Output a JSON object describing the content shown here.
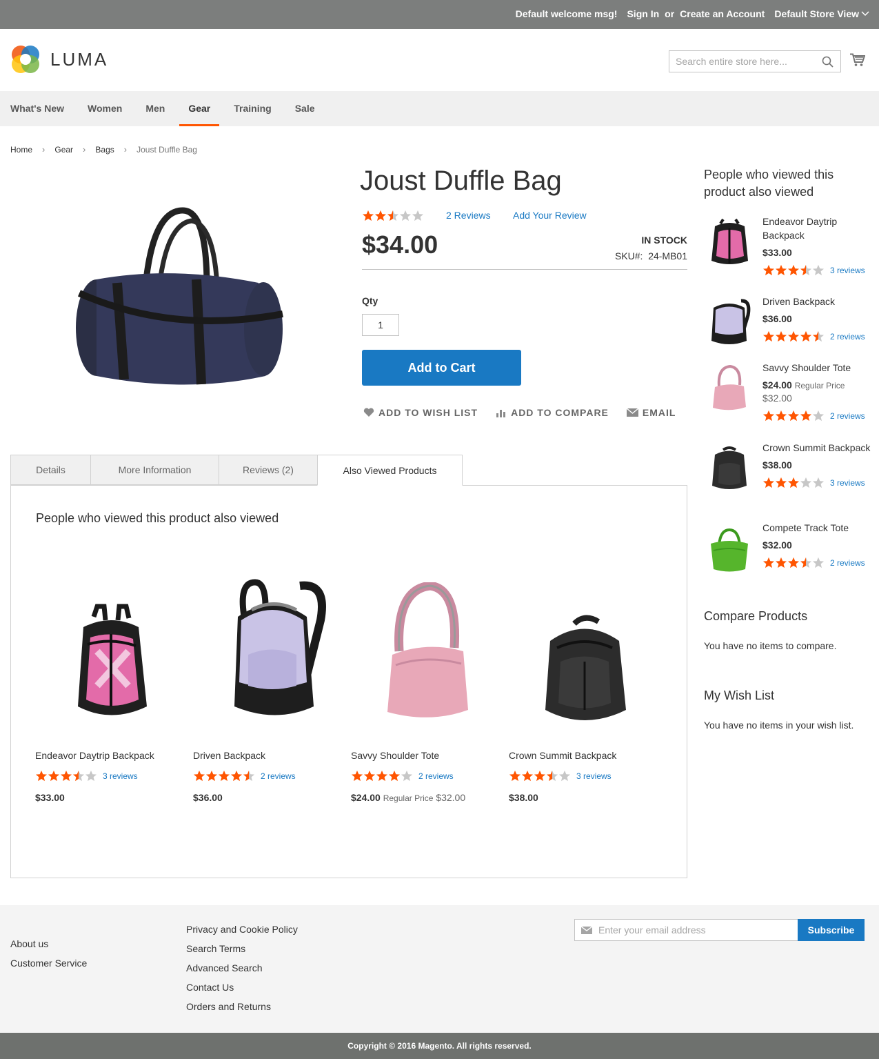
{
  "header": {
    "welcome": "Default welcome msg!",
    "sign_in": "Sign In",
    "or": "or",
    "create_account": "Create an Account",
    "store_view": "Default Store View",
    "logo_text": "LUMA",
    "search_placeholder": "Search entire store here..."
  },
  "nav": {
    "items": [
      "What's New",
      "Women",
      "Men",
      "Gear",
      "Training",
      "Sale"
    ],
    "active": "Gear"
  },
  "breadcrumb": [
    "Home",
    "Gear",
    "Bags",
    "Joust Duffle Bag"
  ],
  "product": {
    "title": "Joust Duffle Bag",
    "rating": 2.5,
    "reviews_link": "2 Reviews",
    "add_review": "Add Your Review",
    "price": "$34.00",
    "stock": "IN STOCK",
    "sku_label": "SKU#:",
    "sku": "24-MB01",
    "qty_label": "Qty",
    "qty": "1",
    "add_to_cart": "Add to Cart",
    "wish_list": "ADD TO WISH LIST",
    "compare": "ADD TO COMPARE",
    "email": "EMAIL"
  },
  "tabs": [
    "Details",
    "More Information",
    "Reviews (2)",
    "Also Viewed Products"
  ],
  "active_tab": "Also Viewed Products",
  "also_viewed": {
    "title": "People who viewed this product also viewed",
    "items": [
      {
        "name": "Endeavor Daytrip Backpack",
        "rating": 3.5,
        "reviews": "3 reviews",
        "price": "$33.00",
        "regular_label": "",
        "regular_price": "",
        "icon": "pink-backpack-image"
      },
      {
        "name": "Driven Backpack",
        "rating": 4.5,
        "reviews": "2 reviews",
        "price": "$36.00",
        "regular_label": "",
        "regular_price": "",
        "icon": "lavender-backpack-image"
      },
      {
        "name": "Savvy Shoulder Tote",
        "rating": 4,
        "reviews": "2 reviews",
        "price": "$24.00",
        "regular_label": "Regular Price",
        "regular_price": "$32.00",
        "icon": "pink-tote-image"
      },
      {
        "name": "Crown Summit Backpack",
        "rating": 3.5,
        "reviews": "3 reviews",
        "price": "$38.00",
        "regular_label": "",
        "regular_price": "",
        "icon": "black-backpack-image"
      }
    ]
  },
  "sidebar": {
    "viewed_title": "People who viewed this product also viewed",
    "items": [
      {
        "name": "Endeavor Daytrip Backpack",
        "price": "$33.00",
        "regular_label": "",
        "regular_price": "",
        "rating": 3.5,
        "reviews": "3 reviews"
      },
      {
        "name": "Driven Backpack",
        "price": "$36.00",
        "regular_label": "",
        "regular_price": "",
        "rating": 4.5,
        "reviews": "2 reviews"
      },
      {
        "name": "Savvy Shoulder Tote",
        "price": "$24.00",
        "regular_label": "Regular Price",
        "regular_price": "$32.00",
        "rating": 4,
        "reviews": "2 reviews"
      },
      {
        "name": "Crown Summit Backpack",
        "price": "$38.00",
        "regular_label": "",
        "regular_price": "",
        "rating": 3,
        "reviews": "3 reviews"
      },
      {
        "name": "Compete Track Tote",
        "price": "$32.00",
        "regular_label": "",
        "regular_price": "",
        "rating": 3.5,
        "reviews": "2 reviews"
      }
    ],
    "compare_title": "Compare Products",
    "compare_note": "You have no items to compare.",
    "wishlist_title": "My Wish List",
    "wishlist_note": "You have no items in your wish list."
  },
  "footer": {
    "col1": [
      "About us",
      "Customer Service"
    ],
    "col2": [
      "Privacy and Cookie Policy",
      "Search Terms",
      "Advanced Search",
      "Contact Us",
      "Orders and Returns"
    ],
    "email_placeholder": "Enter your email address",
    "subscribe": "Subscribe",
    "copyright": "Copyright © 2016 Magento. All rights reserved."
  },
  "colors": {
    "accent": "#1979c3",
    "star": "#ff5501",
    "star_empty": "#c7c7c7",
    "nav_active": "#ff5501"
  }
}
